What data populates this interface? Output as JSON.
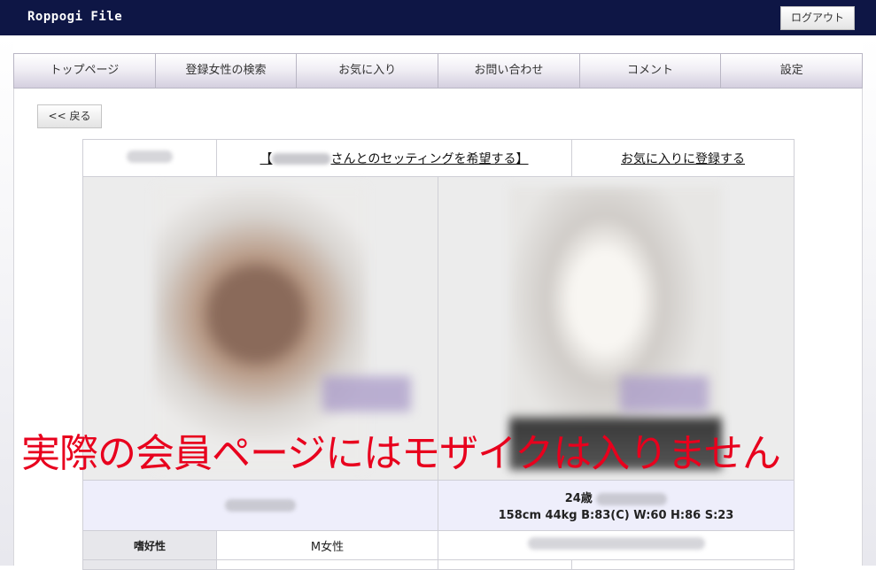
{
  "app": {
    "title": "Roppogi File",
    "logout_label": "ログアウト"
  },
  "nav": {
    "items": [
      {
        "label": "トップページ"
      },
      {
        "label": "登録女性の検索"
      },
      {
        "label": "お気に入り"
      },
      {
        "label": "お問い合わせ"
      },
      {
        "label": "コメント"
      },
      {
        "label": "設定"
      }
    ]
  },
  "back_label": "<< 戻る",
  "profile": {
    "setting_link_prefix": "【",
    "setting_link_suffix": "さんとのセッティングを希望する】",
    "favorite_link": "お気に入りに登録する",
    "age": "24歳",
    "stats": "158cm  44kg  B:83(C) W:60 H:86 S:23",
    "preference_label": "嗜好性",
    "preference_value": "M女性"
  },
  "notice": "実際の会員ページにはモザイクは入りません",
  "colors": {
    "topbar": "#0e1645",
    "notice": "#e8001d",
    "info_row": "#eeeefb"
  }
}
